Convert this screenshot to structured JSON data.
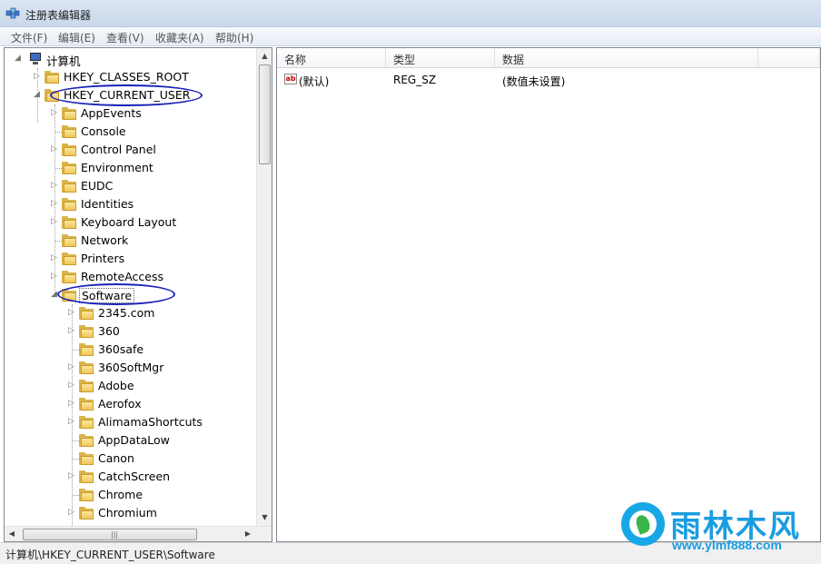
{
  "window": {
    "title": "注册表编辑器"
  },
  "menu": [
    "文件(F)",
    "编辑(E)",
    "查看(V)",
    "收藏夹(A)",
    "帮助(H)"
  ],
  "tree": {
    "root": "计算机",
    "hives": [
      "HKEY_CLASSES_ROOT",
      "HKEY_CURRENT_USER"
    ],
    "current_user_children": [
      "AppEvents",
      "Console",
      "Control Panel",
      "Environment",
      "EUDC",
      "Identities",
      "Keyboard Layout",
      "Network",
      "Printers",
      "RemoteAccess",
      "Software"
    ],
    "software_children": [
      "2345.com",
      "360",
      "360safe",
      "360SoftMgr",
      "Adobe",
      "Aerofox",
      "AlimamaShortcuts",
      "AppDataLow",
      "Canon",
      "CatchScreen",
      "Chrome",
      "Chromium"
    ]
  },
  "list": {
    "columns": [
      "名称",
      "类型",
      "数据"
    ],
    "rows": [
      {
        "name": "(默认)",
        "type": "REG_SZ",
        "data": "(数值未设置)"
      }
    ]
  },
  "status": {
    "path": "计算机\\HKEY_CURRENT_USER\\Software"
  },
  "watermark": {
    "title": "雨林木风",
    "url": "www.ylmf888.com"
  }
}
